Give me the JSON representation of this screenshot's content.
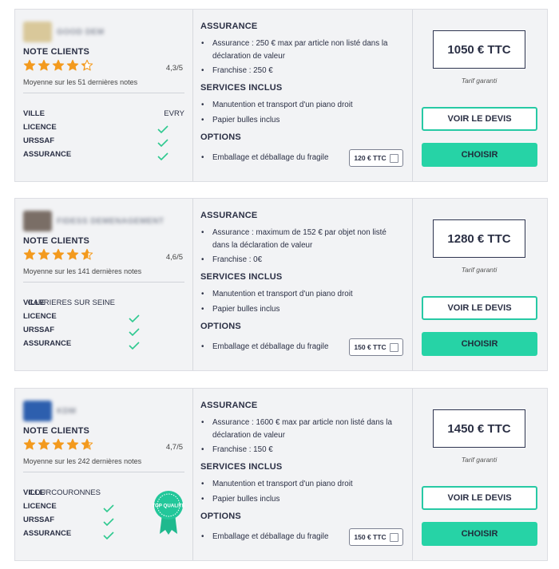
{
  "labels": {
    "note_clients": "NOTE CLIENTS",
    "ville": "VILLE",
    "licence": "LICENCE",
    "urssaf": "URSSAF",
    "assurance_row": "ASSURANCE",
    "assurance_title": "ASSURANCE",
    "services_title": "SERVICES INCLUS",
    "options_title": "OPTIONS",
    "tarif_garanti": "Tarif garanti",
    "voir_devis": "VOIR LE DEVIS",
    "choisir": "CHOISIR",
    "top_qualite": "TOP QUALITÉ"
  },
  "colors": {
    "accent": "#26d3a6",
    "star": "#f39a1e",
    "check": "#2ec98f",
    "badge": "#23c79a"
  },
  "offers": [
    {
      "company": "GOOD DEM",
      "logo_color": "#d9c89a",
      "rating_stars": 4.3,
      "rating": "4,3/5",
      "rating_sub": "Moyenne sur les 51 dernières notes",
      "ville": "EVRY",
      "assurance_items": [
        "Assurance : 250 € max par article non listé dans la déclaration de valeur",
        "Franchise : 250 €"
      ],
      "services": [
        "Manutention et transport d'un piano droit",
        "Papier bulles inclus"
      ],
      "option_label": "Emballage et déballage du fragile",
      "option_price": "120 € TTC",
      "price": "1050 € TTC",
      "top_quality": false
    },
    {
      "company": "FIDESS DEMENAGEMENT",
      "logo_color": "#7a6e66",
      "rating_stars": 4.6,
      "rating": "4,6/5",
      "rating_sub": "Moyenne sur les 141 dernières notes",
      "ville": "CARRIERES SUR SEINE",
      "assurance_items": [
        "Assurance : maximum de 152 € par objet non listé dans la déclaration de valeur",
        "Franchise : 0€"
      ],
      "services": [
        "Manutention et transport d'un piano droit",
        "Papier bulles inclus"
      ],
      "option_label": "Emballage et déballage du fragile",
      "option_price": "150 € TTC",
      "price": "1280 € TTC",
      "top_quality": false
    },
    {
      "company": "KDM",
      "logo_color": "#2d5fae",
      "rating_stars": 4.7,
      "rating": "4,7/5",
      "rating_sub": "Moyenne sur les 242 dernières notes",
      "ville": "COURCOURONNES",
      "assurance_items": [
        "Assurance : 1600 € max par article non listé dans la déclaration de valeur",
        "Franchise : 150 €"
      ],
      "services": [
        "Manutention et transport d'un piano droit",
        "Papier bulles inclus"
      ],
      "option_label": "Emballage et déballage du fragile",
      "option_price": "150 € TTC",
      "price": "1450 € TTC",
      "top_quality": true
    }
  ]
}
